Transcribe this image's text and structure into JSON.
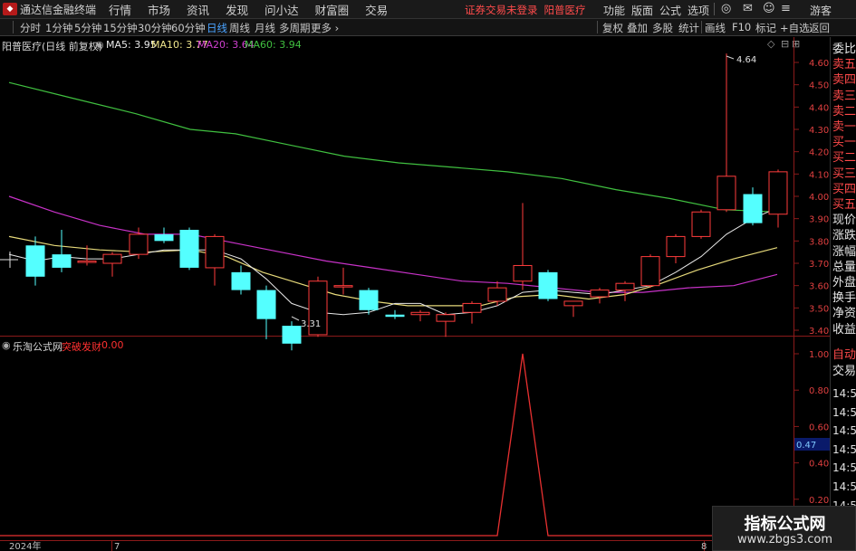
{
  "app": {
    "title": "通达信金融终端",
    "menus": [
      "行情",
      "市场",
      "资讯",
      "发现",
      "问小达",
      "财富圈",
      "交易"
    ],
    "notice": "证券交易未登录",
    "stock_name": "阳普医疗",
    "right_menus": [
      "功能",
      "版面",
      "公式",
      "选项"
    ],
    "user": "游客"
  },
  "toolbar": {
    "periods": [
      "分时",
      "1分钟",
      "5分钟",
      "15分钟",
      "30分钟",
      "60分钟",
      "日线",
      "周线",
      "月线",
      "多周期",
      "更多"
    ],
    "active_period": "日线",
    "buttons": [
      "复权",
      "叠加",
      "多股",
      "统计",
      "画线",
      "F10",
      "标记",
      "+自选",
      "返回"
    ]
  },
  "main_chart": {
    "title": "阳普医疗(日线 前复权)",
    "ma_labels": [
      {
        "label": "MA5: 3.95",
        "color": "#e8e8e8"
      },
      {
        "label": "MA10: 3.77",
        "color": "#f0e68c"
      },
      {
        "label": "MA20: 3.64",
        "color": "#d040d0"
      },
      {
        "label": "MA60: 3.94",
        "color": "#40c040"
      }
    ],
    "high_label": "4.64",
    "low_label": "3.31",
    "y_ticks": [
      "4.60",
      "4.50",
      "4.40",
      "4.30",
      "4.20",
      "4.10",
      "4.00",
      "3.90",
      "3.80",
      "3.70",
      "3.60",
      "3.50",
      "3.40"
    ]
  },
  "side_panel": {
    "top_items": [
      {
        "label": "委比",
        "red": false
      },
      {
        "label": "卖五",
        "red": true
      },
      {
        "label": "卖四",
        "red": true
      },
      {
        "label": "卖三",
        "red": true
      },
      {
        "label": "卖二",
        "red": true
      },
      {
        "label": "卖一",
        "red": true
      },
      {
        "label": "买一",
        "red": true
      },
      {
        "label": "买二",
        "red": true
      },
      {
        "label": "买三",
        "red": true
      },
      {
        "label": "买四",
        "red": true
      },
      {
        "label": "买五",
        "red": true
      },
      {
        "label": "现价",
        "red": false
      },
      {
        "label": "涨跌",
        "red": false
      },
      {
        "label": "涨幅",
        "red": false
      },
      {
        "label": "总量",
        "red": false
      },
      {
        "label": "外盘",
        "red": false
      },
      {
        "label": "换手",
        "red": false
      },
      {
        "label": "净资",
        "red": false
      },
      {
        "label": "收益",
        "red": false
      }
    ],
    "bottom_items": [
      "自动",
      "交易"
    ],
    "times": [
      "14:56",
      "14:56",
      "14:56",
      "14:56",
      "14:56",
      "14:56",
      "14:56",
      "14:56",
      "14:56"
    ]
  },
  "indicator": {
    "title": "乐淘公式网",
    "name": "突破发财",
    "value": "0.00",
    "y_ticks": [
      "1.00",
      "0.80",
      "0.60",
      "0.40",
      "0.20"
    ],
    "current_value": "0.47"
  },
  "x_axis": {
    "labels": [
      "2024年",
      "7",
      "8"
    ]
  },
  "watermark": {
    "line1": "指标公式网",
    "line2": "www.zbgs3.com"
  }
}
